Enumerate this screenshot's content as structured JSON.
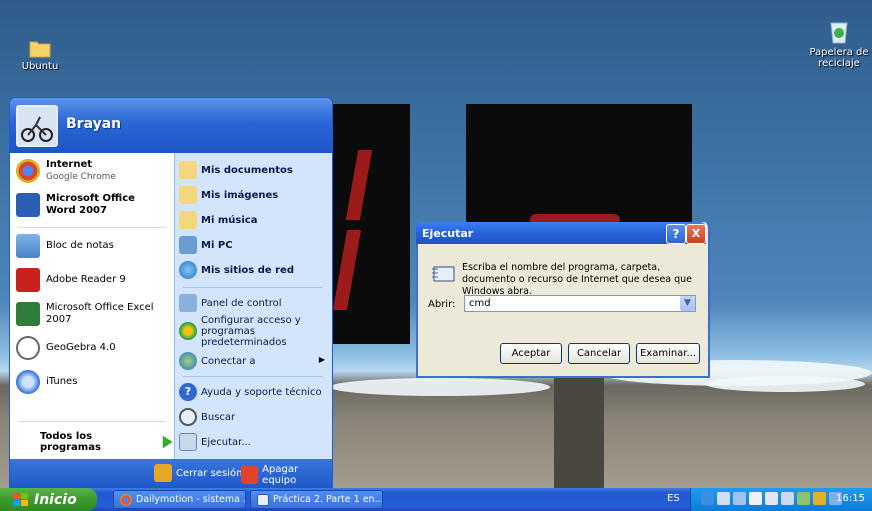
{
  "desktop": {
    "icons": [
      {
        "label": "Ubuntu",
        "icon": "folder-icon"
      },
      {
        "label": "Papelera de reciclaje",
        "icon": "recycle-bin-icon"
      }
    ]
  },
  "start_menu": {
    "user": "Brayan",
    "left_items": [
      {
        "title": "Internet",
        "subtitle": "Google Chrome",
        "bold": true,
        "icon": "chrome-icon"
      },
      {
        "title": "Microsoft Office Word 2007",
        "subtitle": "",
        "bold": true,
        "icon": "word-icon"
      },
      {
        "title": "Bloc de notas",
        "subtitle": "",
        "icon": "notepad-icon"
      },
      {
        "title": "Adobe Reader 9",
        "subtitle": "",
        "icon": "adobe-reader-icon"
      },
      {
        "title": "Microsoft Office Excel 2007",
        "subtitle": "",
        "icon": "excel-icon"
      },
      {
        "title": "GeoGebra 4.0",
        "subtitle": "",
        "icon": "geogebra-icon"
      },
      {
        "title": "iTunes",
        "subtitle": "",
        "icon": "itunes-icon"
      }
    ],
    "all_programs": "Todos los programas",
    "right_items": [
      {
        "label": "Mis documentos",
        "bold": true,
        "icon": "documents-folder-icon"
      },
      {
        "label": "Mis imágenes",
        "bold": true,
        "icon": "pictures-folder-icon"
      },
      {
        "label": "Mi música",
        "bold": true,
        "icon": "music-folder-icon"
      },
      {
        "label": "Mi PC",
        "bold": true,
        "icon": "my-computer-icon"
      },
      {
        "label": "Mis sitios de red",
        "bold": true,
        "icon": "network-places-icon"
      },
      {
        "label": "Panel de control",
        "bold": false,
        "icon": "control-panel-icon"
      },
      {
        "label": "Configurar acceso y programas predeterminados",
        "bold": false,
        "icon": "default-programs-icon"
      },
      {
        "label": "Conectar a",
        "bold": false,
        "icon": "connect-to-icon"
      },
      {
        "label": "Ayuda y soporte técnico",
        "bold": false,
        "icon": "help-icon"
      },
      {
        "label": "Buscar",
        "bold": false,
        "icon": "search-icon"
      },
      {
        "label": "Ejecutar...",
        "bold": false,
        "icon": "run-icon"
      }
    ],
    "logoff": "Cerrar sesión",
    "shutdown": "Apagar equipo"
  },
  "run_dialog": {
    "title": "Ejecutar",
    "help": "?",
    "close": "X",
    "message": "Escriba el nombre del programa, carpeta, documento o recurso de Internet que desea que Windows abra.",
    "open_label": "Abrir:",
    "input_value": "cmd",
    "ok": "Aceptar",
    "cancel": "Cancelar",
    "browse": "Examinar..."
  },
  "taskbar": {
    "start_label": "Inicio",
    "tasks": [
      {
        "label": "Dailymotion - sistema ...",
        "icon": "chrome-icon"
      },
      {
        "label": "Práctica 2. Parte 1 en...",
        "icon": "word-icon"
      }
    ],
    "language": "ES",
    "time": "16:15"
  }
}
